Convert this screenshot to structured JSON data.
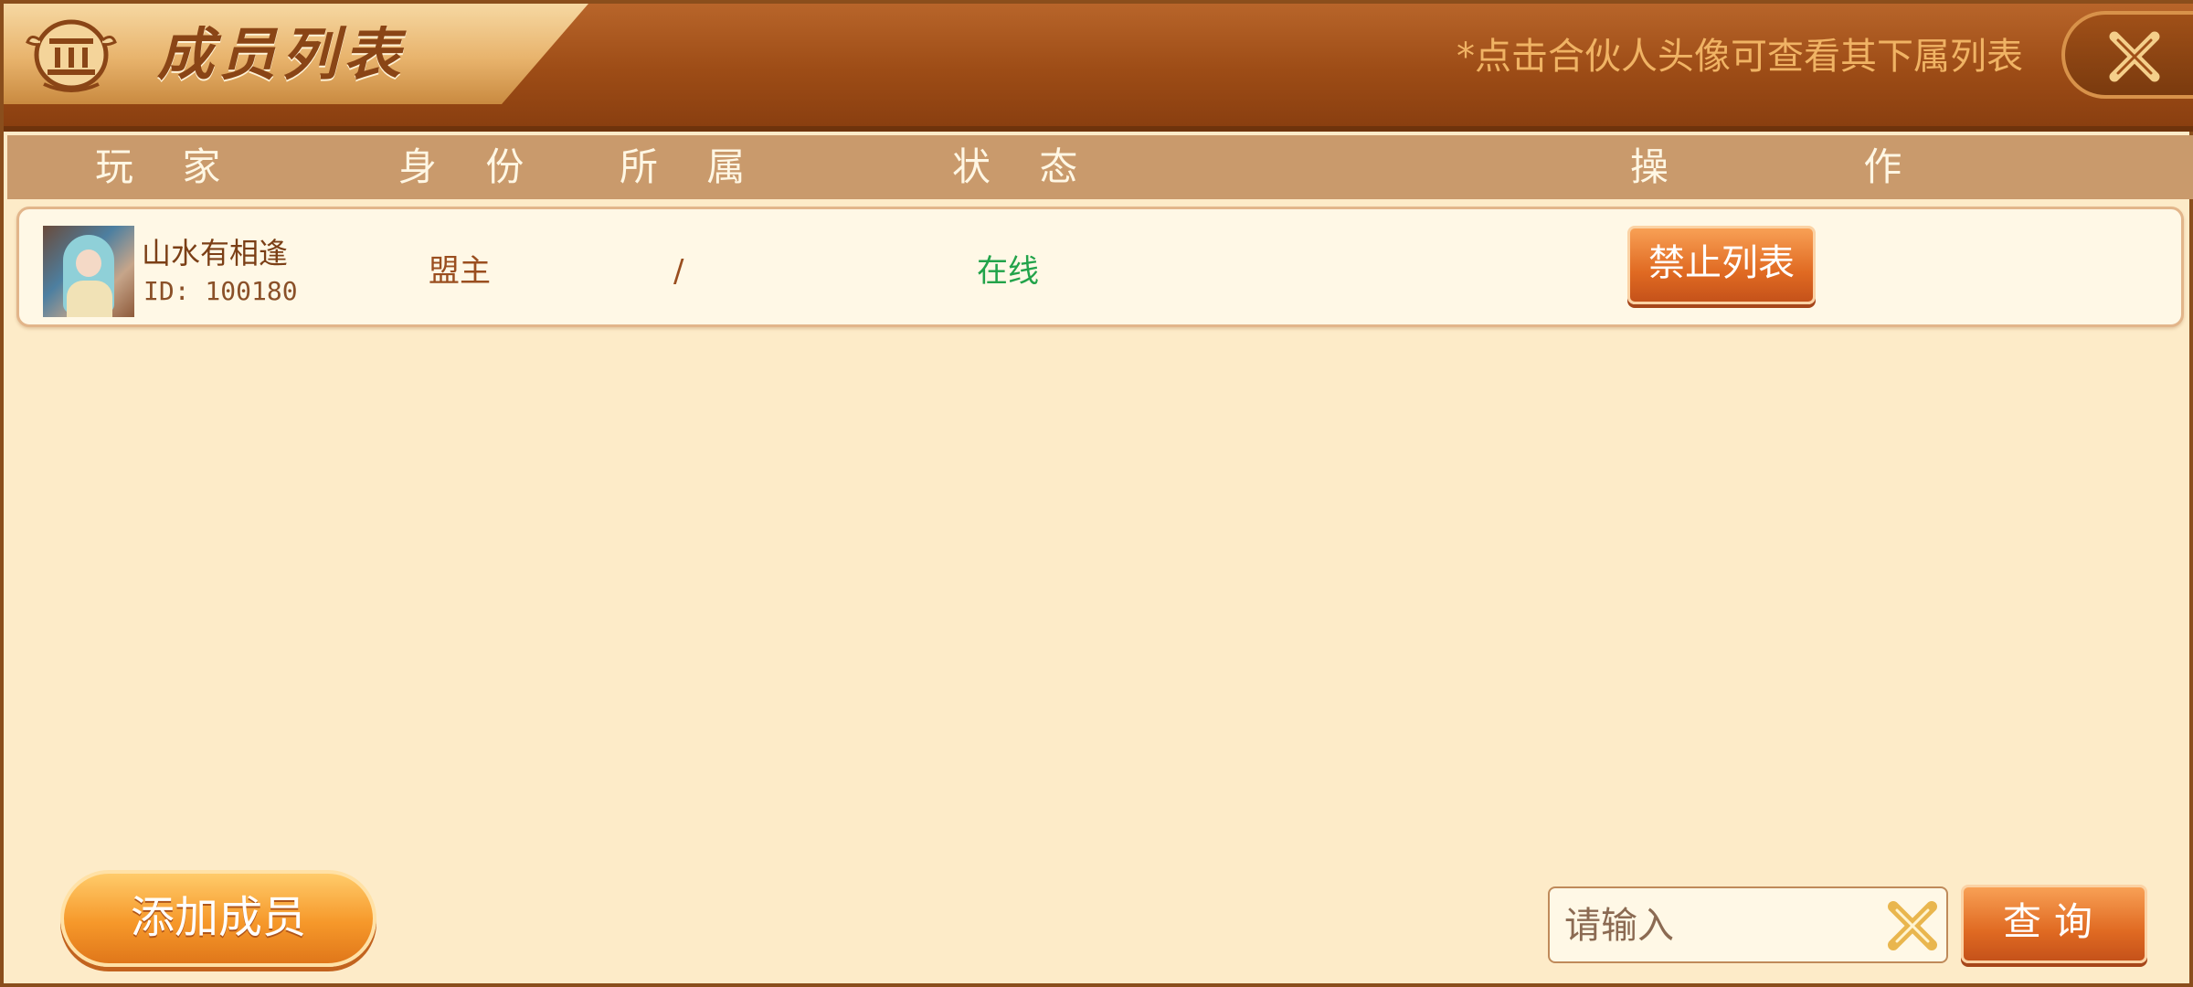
{
  "header": {
    "title": "成员列表",
    "hint": "*点击合伙人头像可查看其下属列表",
    "emblem_icon": "pillar-emblem-icon",
    "close_icon": "close-x-icon"
  },
  "columns": [
    "玩 家",
    "身 份",
    "所 属",
    "状 态",
    "操 作"
  ],
  "members": [
    {
      "name": "山水有相逢",
      "id": "ID: 100180",
      "role": "盟主",
      "belongs": "/",
      "status": "在线",
      "action": "禁止列表"
    }
  ],
  "footer": {
    "add_member": "添加成员",
    "search_placeholder": "请输入",
    "clear_icon": "clear-x-icon",
    "query": "查询"
  },
  "colors": {
    "header": "#9d4c16",
    "panel": "#fdebc8",
    "status_online": "#22a34a",
    "button": "#e06a22"
  }
}
